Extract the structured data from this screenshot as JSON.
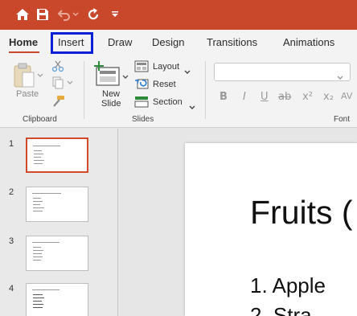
{
  "quick_access": {
    "icons": [
      "home-icon",
      "save-icon",
      "undo-icon",
      "redo-icon",
      "customize-icon"
    ]
  },
  "tabs": [
    "Home",
    "Insert",
    "Draw",
    "Design",
    "Transitions",
    "Animations"
  ],
  "ribbon": {
    "clipboard": {
      "paste": "Paste",
      "group": "Clipboard"
    },
    "slides": {
      "new_slide": "New",
      "new_slide_2": "Slide",
      "layout": "Layout",
      "reset": "Reset",
      "section": "Section",
      "group": "Slides"
    },
    "font": {
      "group": "Font",
      "buttons": [
        "B",
        "I",
        "U",
        "ab",
        "x²",
        "x₂",
        "AV"
      ]
    }
  },
  "thumbnails": [
    {
      "number": "1",
      "selected": true
    },
    {
      "number": "2",
      "selected": false
    },
    {
      "number": "3",
      "selected": false
    },
    {
      "number": "4",
      "selected": false
    }
  ],
  "slide": {
    "title": "Fruits (",
    "items": [
      "1.  Apple",
      "2.  Stra"
    ]
  },
  "colors": {
    "titlebar": "#c9482b",
    "highlight": "#0b1fd6",
    "accent": "#d14a2a"
  }
}
